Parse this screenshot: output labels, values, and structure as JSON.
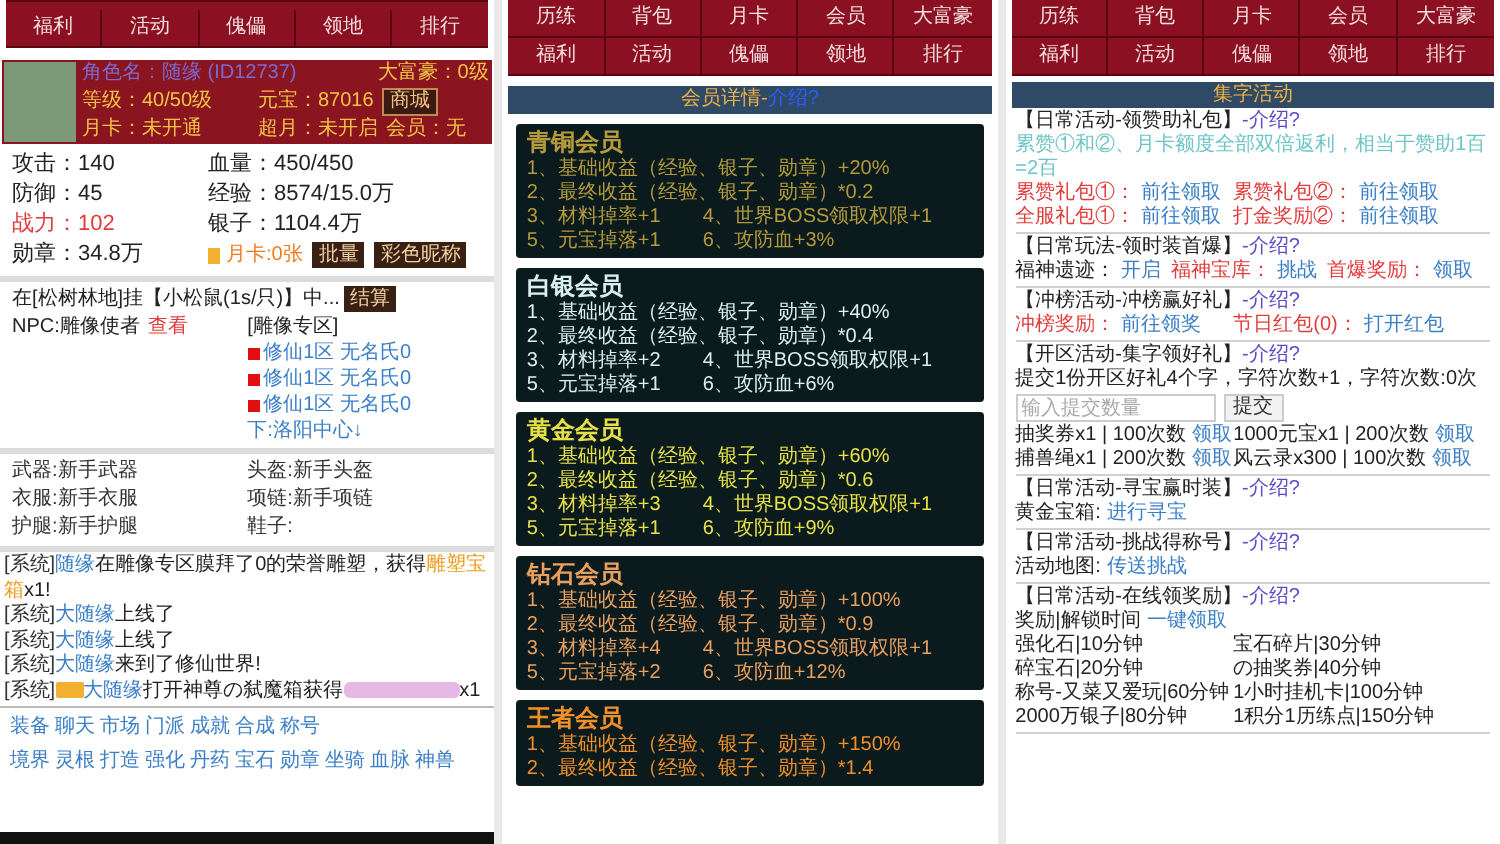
{
  "left_screen": {
    "nav": [
      "福利",
      "活动",
      "傀儡",
      "领地",
      "排行"
    ],
    "profile": {
      "name_label": "角色名：",
      "name": "随缘",
      "id": "(ID12737)",
      "rank": "大富豪：0级",
      "level": "等级：40/50级",
      "yuanbao": "元宝：87016",
      "shop": "商城",
      "month_card": "月卡：未开通",
      "super_month": "超月：未开启",
      "vip": "会员：无"
    },
    "stats": [
      {
        "text": "攻击：140",
        "kind": "plain"
      },
      {
        "text": "血量：450/450",
        "kind": "plain"
      },
      {
        "text": "防御：45",
        "kind": "plain"
      },
      {
        "text": "经验：8574/15.0万",
        "kind": "plain"
      },
      {
        "text": "战力：102",
        "kind": "power"
      },
      {
        "text": "银子：1104.4万",
        "kind": "plain"
      },
      {
        "text": "勋章：34.8万",
        "kind": "plain"
      }
    ],
    "card_row": {
      "text": "月卡:0张",
      "buttons": [
        "批量",
        "彩色昵称"
      ]
    },
    "idle": {
      "text": "在[松树林地]挂【小松鼠(1s/只)】中...",
      "button": "结算",
      "npc_label": "NPC:雕像使者",
      "npc_link": "查看",
      "zone_title": "[雕像专区]",
      "statues": [
        "修仙1区 无名氏0",
        "修仙1区 无名氏0",
        "修仙1区 无名氏0"
      ],
      "next": "下:洛阳中心↓"
    },
    "equipment": [
      "武器:新手武器",
      "头盔:新手头盔",
      "衣服:新手衣服",
      "项链:新手项链",
      "护腿:新手护腿",
      "鞋子:"
    ],
    "chat": [
      [
        {
          "kind": "tag",
          "text": "[系统]"
        },
        {
          "kind": "name",
          "text": "随缘"
        },
        {
          "kind": "text",
          "text": "在雕像专区膜拜了0的荣誉雕塑，获得"
        },
        {
          "kind": "item",
          "text": "雕塑宝箱"
        },
        {
          "kind": "text",
          "text": "x1!"
        }
      ],
      [
        {
          "kind": "tag",
          "text": "[系统]"
        },
        {
          "kind": "name",
          "text": "大随缘"
        },
        {
          "kind": "text",
          "text": "上线了"
        }
      ],
      [
        {
          "kind": "tag",
          "text": "[系统]"
        },
        {
          "kind": "name",
          "text": "大随缘"
        },
        {
          "kind": "text",
          "text": "上线了"
        }
      ],
      [
        {
          "kind": "tag",
          "text": "[系统]"
        },
        {
          "kind": "name",
          "text": "大随缘"
        },
        {
          "kind": "text",
          "text": "来到了修仙世界!"
        }
      ],
      [
        {
          "kind": "tag",
          "text": "[系统]"
        },
        {
          "kind": "badge"
        },
        {
          "kind": "name",
          "text": "大随缘"
        },
        {
          "kind": "text",
          "text": "打开神尊の弑魔箱获得"
        },
        {
          "kind": "blurred"
        },
        {
          "kind": "text",
          "text": "x1"
        }
      ]
    ],
    "links": [
      [
        "装备",
        "聊天",
        "市场",
        "门派",
        "成就",
        "合成",
        "称号"
      ],
      [
        "境界",
        "灵根",
        "打造",
        "强化",
        "丹药",
        "宝石",
        "勋章",
        "坐骑",
        "血脉",
        "神兽"
      ]
    ]
  },
  "middle_screen": {
    "nav": [
      [
        "历练",
        "背包",
        "月卡",
        "会员",
        "大富豪"
      ],
      [
        "福利",
        "活动",
        "傀儡",
        "领地",
        "排行"
      ]
    ],
    "header": {
      "title": "会员详情-",
      "link": "介绍?"
    },
    "cards": [
      {
        "title": "青铜会员",
        "color": "#b39a3c",
        "lines": [
          "1、基础收益（经验、银子、勋章）+20%",
          "2、最终收益（经验、银子、勋章）*0.2",
          "3、材料掉率+1",
          "4、世界BOSS领取权限+1",
          "5、元宝掉落+1",
          "6、攻防血+3%"
        ]
      },
      {
        "title": "白银会员",
        "color": "#d8f0f0",
        "lines": [
          "1、基础收益（经验、银子、勋章）+40%",
          "2、最终收益（经验、银子、勋章）*0.4",
          "3、材料掉率+2",
          "4、世界BOSS领取权限+1",
          "5、元宝掉落+1",
          "6、攻防血+6%"
        ]
      },
      {
        "title": "黄金会员",
        "color": "#e6e048",
        "lines": [
          "1、基础收益（经验、银子、勋章）+60%",
          "2、最终收益（经验、银子、勋章）*0.6",
          "3、材料掉率+3",
          "4、世界BOSS领取权限+1",
          "5、元宝掉落+1",
          "6、攻防血+9%"
        ]
      },
      {
        "title": "钻石会员",
        "color": "#e8a060",
        "lines": [
          "1、基础收益（经验、银子、勋章）+100%",
          "2、最终收益（经验、银子、勋章）*0.9",
          "3、材料掉率+4",
          "4、世界BOSS领取权限+1",
          "5、元宝掉落+2",
          "6、攻防血+12%"
        ]
      },
      {
        "title": "王者会员",
        "color": "#f0902a",
        "lines": [
          "1、基础收益（经验、银子、勋章）+150%",
          "2、最终收益（经验、银子、勋章）*1.4"
        ]
      }
    ]
  },
  "right_screen": {
    "nav": [
      [
        "历练",
        "背包",
        "月卡",
        "会员",
        "大富豪"
      ],
      [
        "福利",
        "活动",
        "傀儡",
        "领地",
        "排行"
      ]
    ],
    "header": "集字活动",
    "sections": [
      {
        "title": "【日常活动-领赞助礼包】",
        "intro": "-介绍?",
        "rows": [
          {
            "kind": "note",
            "text": "累赞①和②、月卡额度全部双倍返利，相当于赞助1百=2百"
          },
          {
            "kind": "grid",
            "cells": [
              [
                {
                  "kind": "label",
                  "text": "累赞礼包①："
                },
                {
                  "kind": "link",
                  "text": "前往领取"
                }
              ],
              [
                {
                  "kind": "label",
                  "text": "累赞礼包②："
                },
                {
                  "kind": "link",
                  "text": "前往领取"
                }
              ]
            ]
          },
          {
            "kind": "grid",
            "cells": [
              [
                {
                  "kind": "label",
                  "text": "全服礼包①："
                },
                {
                  "kind": "link",
                  "text": "前往领取"
                }
              ],
              [
                {
                  "kind": "label",
                  "text": "打金奖励②："
                },
                {
                  "kind": "link",
                  "text": "前往领取"
                }
              ]
            ]
          }
        ]
      },
      {
        "title": "【日常玩法-领时装首爆】",
        "intro": "-介绍?",
        "rows": [
          {
            "kind": "inline",
            "groups": [
              [
                {
                  "kind": "text",
                  "text": "福神遗迹："
                },
                {
                  "kind": "link",
                  "text": "开启"
                }
              ],
              [
                {
                  "kind": "label",
                  "text": "福神宝库："
                },
                {
                  "kind": "link",
                  "text": "挑战"
                }
              ],
              [
                {
                  "kind": "label",
                  "text": "首爆奖励："
                },
                {
                  "kind": "link",
                  "text": "领取"
                }
              ]
            ]
          }
        ]
      },
      {
        "title": "【冲榜活动-冲榜赢好礼】",
        "intro": "-介绍?",
        "rows": [
          {
            "kind": "grid",
            "cells": [
              [
                {
                  "kind": "label",
                  "text": "冲榜奖励："
                },
                {
                  "kind": "link",
                  "text": "前往领奖"
                }
              ],
              [
                {
                  "kind": "label",
                  "text": "节日红包(0)："
                },
                {
                  "kind": "link",
                  "text": "打开红包"
                }
              ]
            ]
          }
        ]
      },
      {
        "title": "【开区活动-集字领好礼】",
        "intro": "-介绍?",
        "rows": [
          {
            "kind": "text",
            "text": "提交1份开区好礼4个字，字符次数+1，字符次数:0次"
          },
          {
            "kind": "input",
            "placeholder": "输入提交数量",
            "button": "提交"
          },
          {
            "kind": "grid",
            "cells": [
              [
                {
                  "kind": "text",
                  "text": "抽奖券x1 | 100次数"
                },
                {
                  "kind": "link",
                  "text": "领取"
                }
              ],
              [
                {
                  "kind": "text",
                  "text": "1000元宝x1 | 200次数"
                },
                {
                  "kind": "link",
                  "text": "领取"
                }
              ]
            ]
          },
          {
            "kind": "grid",
            "cells": [
              [
                {
                  "kind": "text",
                  "text": "捕兽绳x1 | 200次数"
                },
                {
                  "kind": "link",
                  "text": "领取"
                }
              ],
              [
                {
                  "kind": "text",
                  "text": "风云录x300 | 100次数"
                },
                {
                  "kind": "link",
                  "text": "领取"
                }
              ]
            ]
          }
        ]
      },
      {
        "title": "【日常活动-寻宝赢时装】",
        "intro": "-介绍?",
        "rows": [
          {
            "kind": "inline",
            "groups": [
              [
                {
                  "kind": "text",
                  "text": "黄金宝箱:"
                },
                {
                  "kind": "link",
                  "text": "进行寻宝"
                }
              ]
            ]
          }
        ]
      },
      {
        "title": "【日常活动-挑战得称号】",
        "intro": "-介绍?",
        "rows": [
          {
            "kind": "inline",
            "groups": [
              [
                {
                  "kind": "text",
                  "text": "活动地图:"
                },
                {
                  "kind": "link",
                  "text": "传送挑战"
                }
              ]
            ]
          }
        ]
      },
      {
        "title": "【日常活动-在线领奖励】",
        "intro": "-介绍?",
        "rows": [
          {
            "kind": "inline",
            "groups": [
              [
                {
                  "kind": "text",
                  "text": "奖励|解锁时间"
                },
                {
                  "kind": "link",
                  "text": "一键领取"
                }
              ]
            ]
          },
          {
            "kind": "grid",
            "cells": [
              [
                {
                  "kind": "text",
                  "text": "强化石|10分钟"
                }
              ],
              [
                {
                  "kind": "text",
                  "text": "宝石碎片|30分钟"
                }
              ]
            ]
          },
          {
            "kind": "grid",
            "cells": [
              [
                {
                  "kind": "text",
                  "text": "碎宝石|20分钟"
                }
              ],
              [
                {
                  "kind": "text",
                  "text": "の抽奖券|40分钟"
                }
              ]
            ]
          },
          {
            "kind": "grid",
            "cells": [
              [
                {
                  "kind": "text",
                  "text": "称号-又菜又爱玩|60分钟"
                }
              ],
              [
                {
                  "kind": "text",
                  "text": "1小时挂机卡|100分钟"
                }
              ]
            ]
          },
          {
            "kind": "grid",
            "cells": [
              [
                {
                  "kind": "text",
                  "text": "2000万银子|80分钟"
                }
              ],
              [
                {
                  "kind": "text",
                  "text": "1积分1历练点|150分钟"
                }
              ]
            ]
          }
        ]
      }
    ]
  }
}
